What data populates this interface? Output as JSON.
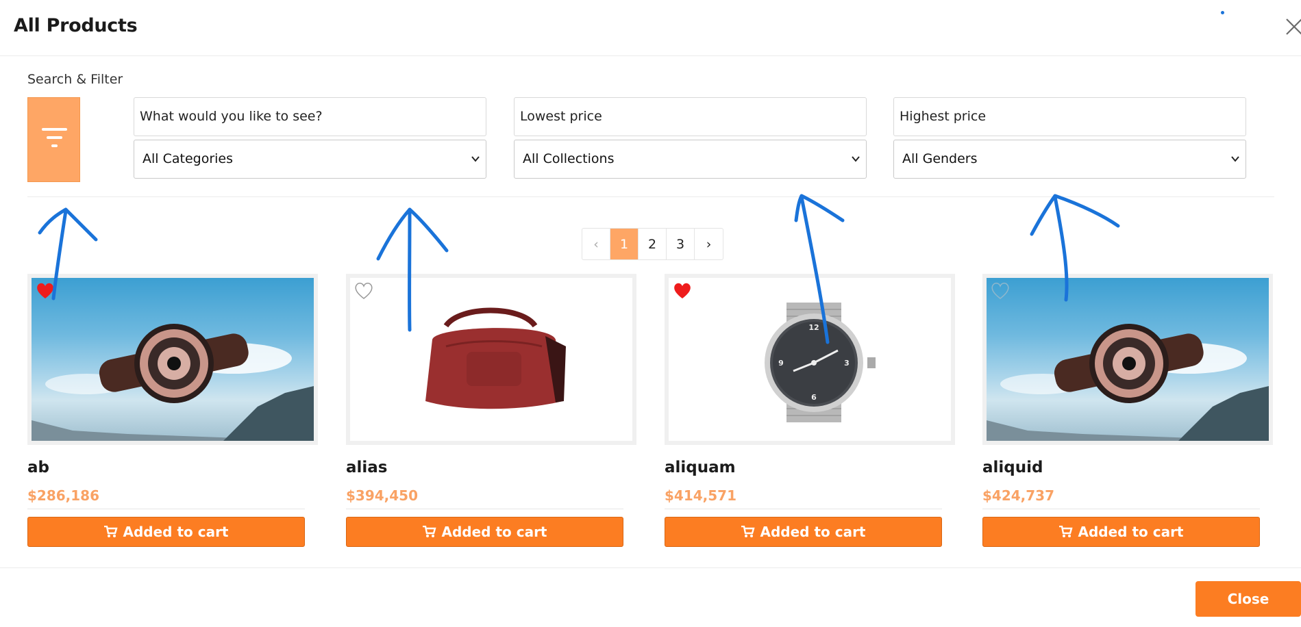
{
  "modal": {
    "title": "All Products",
    "close_icon": "close-icon",
    "footer_close_label": "Close"
  },
  "filters": {
    "section_label": "Search & Filter",
    "filter_icon": "filter-icon",
    "search_placeholder": "What would you like to see?",
    "lowest_price_placeholder": "Lowest price",
    "highest_price_placeholder": "Highest price",
    "category_selected": "All Categories",
    "collection_selected": "All Collections",
    "gender_selected": "All Genders"
  },
  "pagination": {
    "prev": "‹",
    "pages": [
      "1",
      "2",
      "3"
    ],
    "active_page": "1",
    "next": "›"
  },
  "products": [
    {
      "name": "ab",
      "price": "$286,186",
      "favorited": true,
      "image": "watch-on-sky",
      "cart_label": "Added to cart"
    },
    {
      "name": "alias",
      "price": "$394,450",
      "favorited": false,
      "image": "red-bag",
      "cart_label": "Added to cart"
    },
    {
      "name": "aliquam",
      "price": "$414,571",
      "favorited": true,
      "image": "mesh-watch",
      "cart_label": "Added to cart"
    },
    {
      "name": "aliquid",
      "price": "$424,737",
      "favorited": false,
      "image": "watch-on-sky",
      "cart_label": "Added to cart"
    }
  ],
  "colors": {
    "accent_light": "#fea665",
    "accent": "#fc7d22",
    "price": "#f9a264",
    "heart": "#ee1c1c",
    "annotation": "#1a73d9"
  }
}
